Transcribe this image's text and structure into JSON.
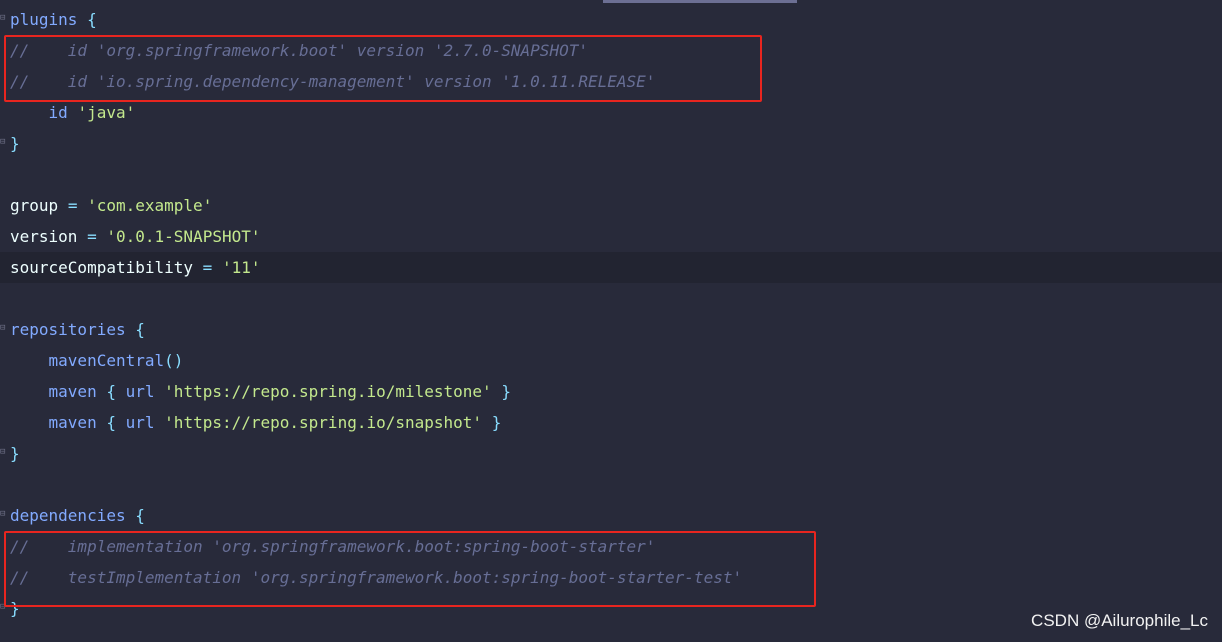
{
  "editor": {
    "lines": [
      {
        "tokens": [
          [
            "kw-block",
            "plugins"
          ],
          [
            "plain",
            " "
          ],
          [
            "brace",
            "{"
          ]
        ],
        "fold": "⊟"
      },
      {
        "tokens": [
          [
            "comment",
            "//    id 'org.springframework.boot' version '2.7.0-SNAPSHOT'"
          ]
        ]
      },
      {
        "tokens": [
          [
            "comment",
            "//    id 'io.spring.dependency-management' version '1.0.11.RELEASE'"
          ]
        ]
      },
      {
        "tokens": [
          [
            "plain",
            "    "
          ],
          [
            "kw",
            "id"
          ],
          [
            "plain",
            " "
          ],
          [
            "str",
            "'java'"
          ]
        ]
      },
      {
        "tokens": [
          [
            "brace",
            "}"
          ]
        ],
        "fold": "⊟"
      },
      {
        "tokens": []
      },
      {
        "tokens": [
          [
            "ident",
            "group"
          ],
          [
            "plain",
            " "
          ],
          [
            "op",
            "="
          ],
          [
            "plain",
            " "
          ],
          [
            "str",
            "'com.example'"
          ]
        ]
      },
      {
        "tokens": [
          [
            "ident",
            "version"
          ],
          [
            "plain",
            " "
          ],
          [
            "op",
            "="
          ],
          [
            "plain",
            " "
          ],
          [
            "str",
            "'0.0.1-SNAPSHOT'"
          ]
        ]
      },
      {
        "tokens": [
          [
            "ident",
            "sourceCompatibility"
          ],
          [
            "plain",
            " "
          ],
          [
            "op",
            "="
          ],
          [
            "plain",
            " "
          ],
          [
            "str",
            "'11'"
          ]
        ],
        "current": true
      },
      {
        "tokens": []
      },
      {
        "tokens": [
          [
            "kw-block",
            "repositories"
          ],
          [
            "plain",
            " "
          ],
          [
            "brace",
            "{"
          ]
        ],
        "fold": "⊟"
      },
      {
        "tokens": [
          [
            "plain",
            "    "
          ],
          [
            "fn",
            "mavenCentral"
          ],
          [
            "brace",
            "()"
          ]
        ]
      },
      {
        "tokens": [
          [
            "plain",
            "    "
          ],
          [
            "fn",
            "maven"
          ],
          [
            "plain",
            " "
          ],
          [
            "brace",
            "{"
          ],
          [
            "plain",
            " "
          ],
          [
            "kw",
            "url"
          ],
          [
            "plain",
            " "
          ],
          [
            "str",
            "'https://repo.spring.io/milestone'"
          ],
          [
            "plain",
            " "
          ],
          [
            "brace",
            "}"
          ]
        ]
      },
      {
        "tokens": [
          [
            "plain",
            "    "
          ],
          [
            "fn",
            "maven"
          ],
          [
            "plain",
            " "
          ],
          [
            "brace",
            "{"
          ],
          [
            "plain",
            " "
          ],
          [
            "kw",
            "url"
          ],
          [
            "plain",
            " "
          ],
          [
            "str",
            "'https://repo.spring.io/snapshot'"
          ],
          [
            "plain",
            " "
          ],
          [
            "brace",
            "}"
          ]
        ]
      },
      {
        "tokens": [
          [
            "brace",
            "}"
          ]
        ],
        "fold": "⊟"
      },
      {
        "tokens": []
      },
      {
        "tokens": [
          [
            "kw-block",
            "dependencies"
          ],
          [
            "plain",
            " "
          ],
          [
            "brace",
            "{"
          ]
        ],
        "fold": "⊟"
      },
      {
        "tokens": [
          [
            "comment",
            "//    implementation 'org.springframework.boot:spring-boot-starter'"
          ]
        ]
      },
      {
        "tokens": [
          [
            "comment",
            "//    testImplementation 'org.springframework.boot:spring-boot-starter-test'"
          ]
        ]
      },
      {
        "tokens": [
          [
            "brace",
            "}"
          ]
        ],
        "fold": "⊟"
      }
    ]
  },
  "watermark": "CSDN @Ailurophile_Lc",
  "colors": {
    "background": "#282a3a",
    "current_line": "#222431",
    "annotation_border": "#e8251f",
    "keyword": "#82aaff",
    "string": "#c3e88d",
    "comment": "#676e95",
    "operator": "#89ddff",
    "text": "#eeffff"
  }
}
